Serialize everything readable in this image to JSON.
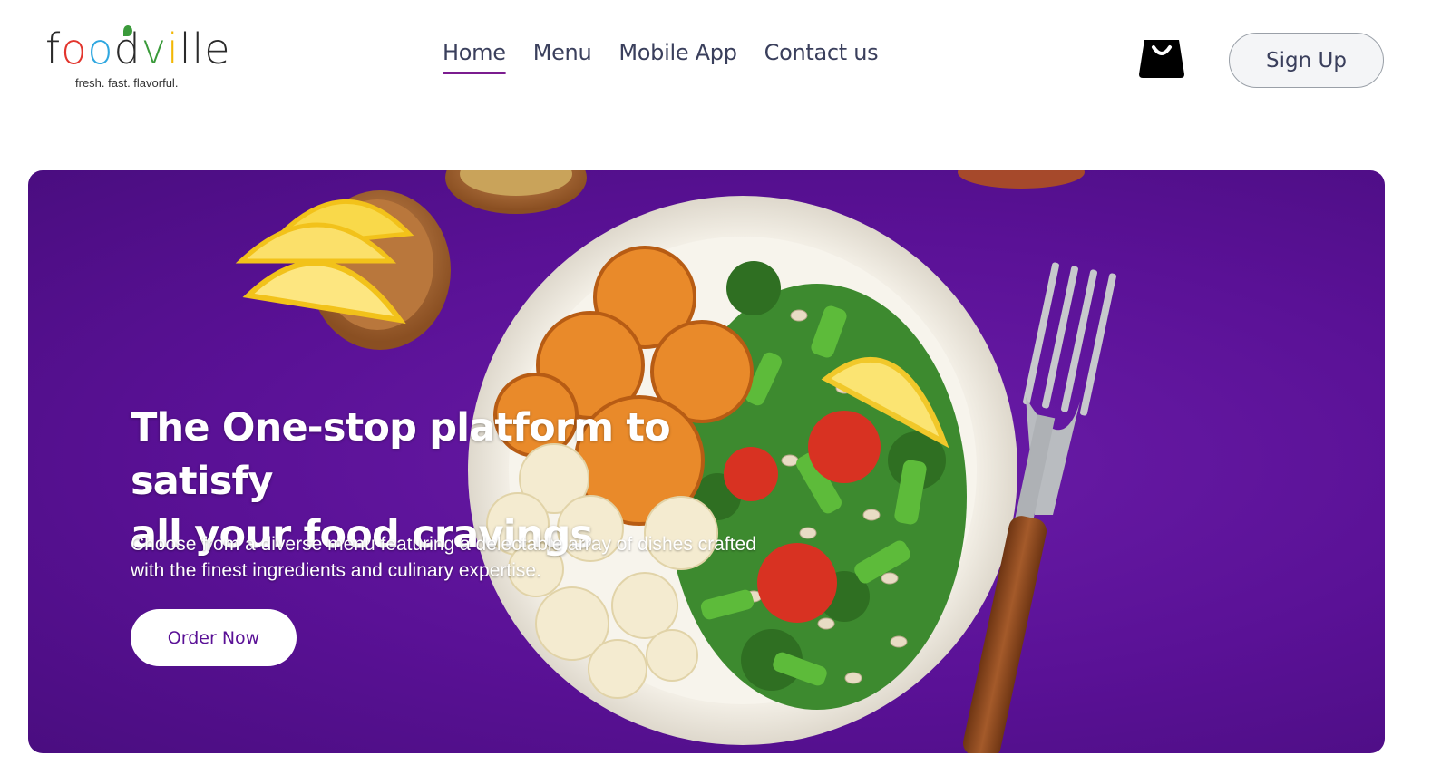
{
  "brand": {
    "logo_letters": [
      "f",
      "o",
      "o",
      "d",
      "v",
      "i",
      "ll",
      "e"
    ],
    "tagline": "fresh. fast. flavorful."
  },
  "nav": {
    "items": [
      {
        "label": "Home",
        "active": true
      },
      {
        "label": "Menu",
        "active": false
      },
      {
        "label": "Mobile App",
        "active": false
      },
      {
        "label": "Contact us",
        "active": false
      }
    ]
  },
  "header": {
    "cart_icon": "shopping-bag-icon",
    "signup_label": "Sign Up"
  },
  "hero": {
    "title_line1": "The One-stop platform to satisfy",
    "title_line2": "all your food cravings",
    "subtitle_line1": "Choose from a diverse menu featuring a delectable array of dishes crafted",
    "subtitle_line2": "with the finest ingredients and culinary expertise.",
    "cta_label": "Order Now"
  },
  "colors": {
    "accent": "#7b1c8f",
    "hero_background": "#5a1196",
    "nav_text": "#3a3f5c"
  }
}
